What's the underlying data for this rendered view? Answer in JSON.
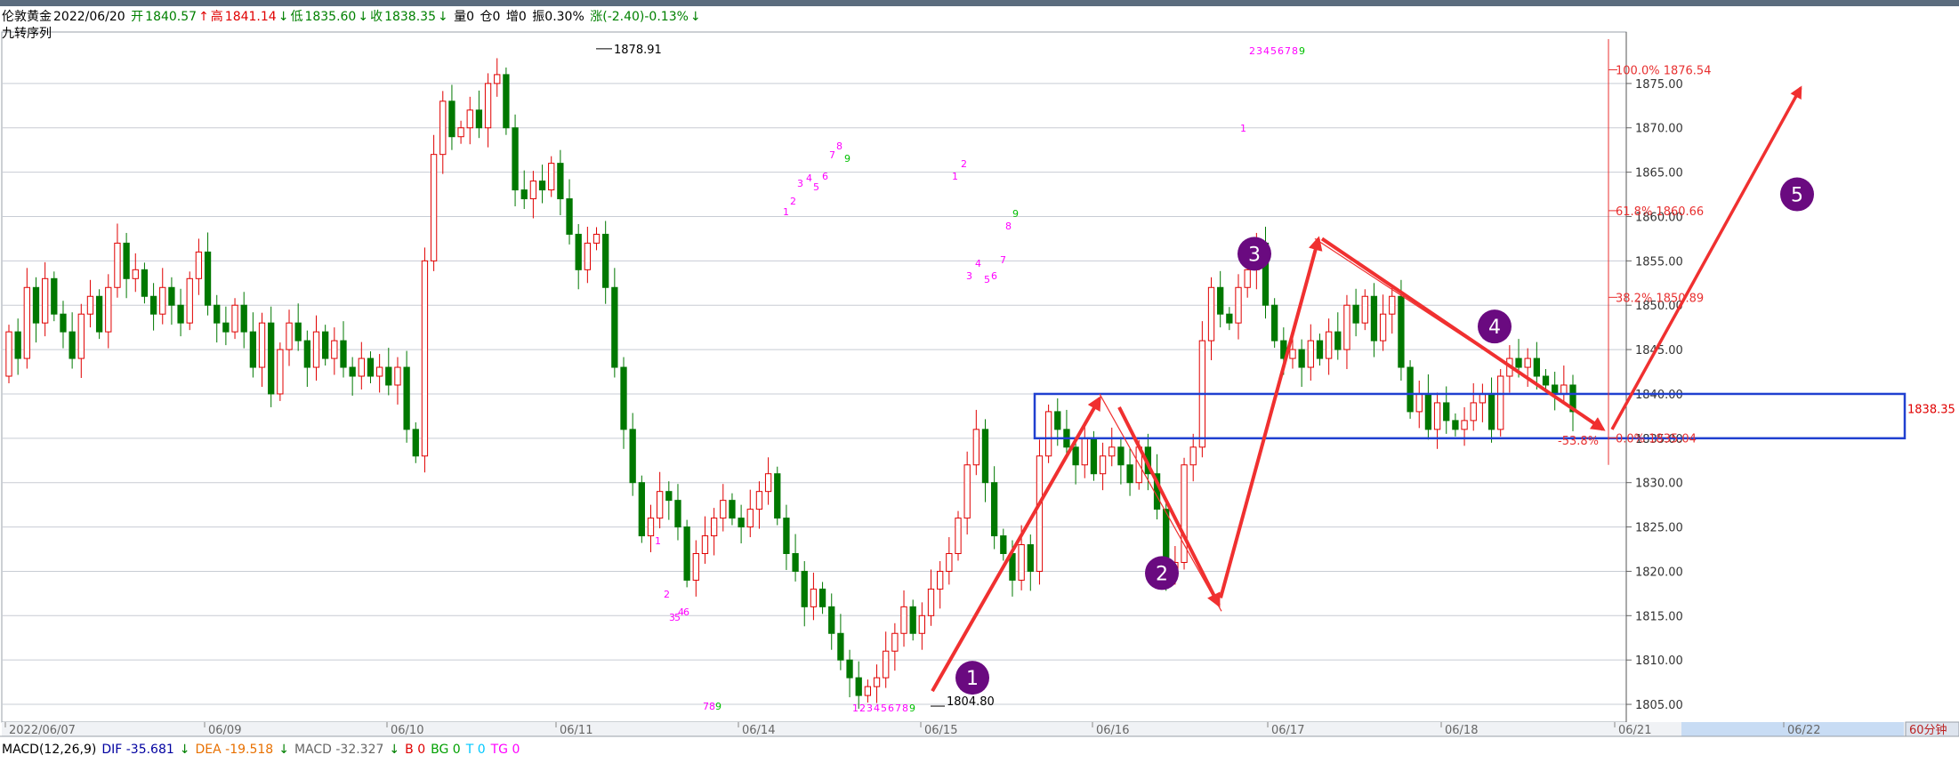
{
  "header": {
    "symbol": "伦敦黄金",
    "date": "2022/06/20",
    "open_label": "开",
    "open": "1840.57",
    "high_label": "高",
    "high": "1841.14",
    "low_label": "低",
    "low": "1835.60",
    "close_label": "收",
    "close": "1838.35",
    "vol": "量0",
    "oi": "仓0",
    "inc": "增0",
    "amp": "振0.30%",
    "chg": "涨(-2.40)-0.13%",
    "up_arrow": "↑",
    "down_arrow": "↓"
  },
  "indicator_name": "九转序列",
  "macd": {
    "params": "MACD(12,26,9)",
    "dif": "DIF -35.681",
    "dif_arrow": "↓",
    "dea": "DEA -19.518",
    "dea_arrow": "↓",
    "macd": "MACD -32.327",
    "macd_arrow": "↓",
    "b": "B 0",
    "bg": "BG 0",
    "t": "T 0",
    "tg": "TG 0"
  },
  "period": "60分钟",
  "colors": {
    "up": "#e00000",
    "down": "#007800",
    "zone": "#2040d0",
    "arrow": "#f03030",
    "circle": "#6a0a80",
    "fib": "#e83030",
    "grid": "#c8ccd4",
    "nine_a": "#ff00ff",
    "nine_b": "#00c000"
  },
  "chart_data": {
    "type": "candlestick",
    "y_axis": {
      "min": 1805,
      "max": 1875,
      "ticks": [
        "1805.00",
        "1810.00",
        "1815.00",
        "1820.00",
        "1825.00",
        "1830.00",
        "1835.00",
        "1840.00",
        "1845.00",
        "1850.00",
        "1855.00",
        "1860.00",
        "1865.00",
        "1870.00",
        "1875.00"
      ]
    },
    "x_labels": [
      "2022/06/07",
      "06/09",
      "06/10",
      "06/11",
      "06/14",
      "06/15",
      "06/16",
      "06/17",
      "06/18",
      "06/21",
      "06/22"
    ],
    "current_price": "1838.35",
    "extremes": [
      {
        "label": "1878.91",
        "price": 1878.91
      },
      {
        "label": "1804.80",
        "price": 1804.8
      }
    ],
    "candles": [
      [
        1842,
        1847
      ],
      [
        1847,
        1844
      ],
      [
        1844,
        1852
      ],
      [
        1852,
        1848
      ],
      [
        1848,
        1853
      ],
      [
        1853,
        1849
      ],
      [
        1849,
        1847
      ],
      [
        1847,
        1844
      ],
      [
        1844,
        1849
      ],
      [
        1849,
        1851
      ],
      [
        1851,
        1847
      ],
      [
        1847,
        1852
      ],
      [
        1852,
        1857
      ],
      [
        1857,
        1853
      ],
      [
        1853,
        1854
      ],
      [
        1854,
        1851
      ],
      [
        1851,
        1849
      ],
      [
        1849,
        1852
      ],
      [
        1852,
        1850
      ],
      [
        1850,
        1848
      ],
      [
        1848,
        1853
      ],
      [
        1853,
        1856
      ],
      [
        1856,
        1850
      ],
      [
        1850,
        1848
      ],
      [
        1848,
        1847
      ],
      [
        1847,
        1850
      ],
      [
        1850,
        1847
      ],
      [
        1847,
        1843
      ],
      [
        1843,
        1848
      ],
      [
        1848,
        1840
      ],
      [
        1840,
        1845
      ],
      [
        1845,
        1848
      ],
      [
        1848,
        1846
      ],
      [
        1846,
        1843
      ],
      [
        1843,
        1847
      ],
      [
        1847,
        1844
      ],
      [
        1844,
        1846
      ],
      [
        1846,
        1843
      ],
      [
        1843,
        1842
      ],
      [
        1842,
        1844
      ],
      [
        1844,
        1842
      ],
      [
        1842,
        1843
      ],
      [
        1843,
        1841
      ],
      [
        1841,
        1843
      ],
      [
        1843,
        1836
      ],
      [
        1836,
        1833
      ],
      [
        1833,
        1855
      ],
      [
        1855,
        1867
      ],
      [
        1867,
        1873
      ],
      [
        1873,
        1869
      ],
      [
        1869,
        1870
      ],
      [
        1870,
        1872
      ],
      [
        1872,
        1870
      ],
      [
        1870,
        1875
      ],
      [
        1875,
        1876
      ],
      [
        1876,
        1870
      ],
      [
        1870,
        1863
      ],
      [
        1863,
        1862
      ],
      [
        1862,
        1864
      ],
      [
        1864,
        1863
      ],
      [
        1863,
        1866
      ],
      [
        1866,
        1862
      ],
      [
        1862,
        1858
      ],
      [
        1858,
        1854
      ],
      [
        1854,
        1857
      ],
      [
        1857,
        1858
      ],
      [
        1858,
        1852
      ],
      [
        1852,
        1843
      ],
      [
        1843,
        1836
      ],
      [
        1836,
        1830
      ],
      [
        1830,
        1824
      ],
      [
        1824,
        1826
      ],
      [
        1826,
        1829
      ],
      [
        1829,
        1828
      ],
      [
        1828,
        1825
      ],
      [
        1825,
        1819
      ],
      [
        1819,
        1822
      ],
      [
        1822,
        1824
      ],
      [
        1824,
        1826
      ],
      [
        1826,
        1828
      ],
      [
        1828,
        1826
      ],
      [
        1826,
        1825
      ],
      [
        1825,
        1827
      ],
      [
        1827,
        1829
      ],
      [
        1829,
        1831
      ],
      [
        1831,
        1826
      ],
      [
        1826,
        1822
      ],
      [
        1822,
        1820
      ],
      [
        1820,
        1816
      ],
      [
        1816,
        1818
      ],
      [
        1818,
        1816
      ],
      [
        1816,
        1813
      ],
      [
        1813,
        1810
      ],
      [
        1810,
        1808
      ],
      [
        1808,
        1806
      ],
      [
        1806,
        1807
      ],
      [
        1807,
        1808
      ],
      [
        1808,
        1811
      ],
      [
        1811,
        1813
      ],
      [
        1813,
        1816
      ],
      [
        1816,
        1813
      ],
      [
        1813,
        1815
      ],
      [
        1815,
        1818
      ],
      [
        1818,
        1820
      ],
      [
        1820,
        1822
      ],
      [
        1822,
        1826
      ],
      [
        1826,
        1832
      ],
      [
        1832,
        1836
      ],
      [
        1836,
        1830
      ],
      [
        1830,
        1824
      ],
      [
        1824,
        1822
      ],
      [
        1822,
        1819
      ],
      [
        1819,
        1823
      ],
      [
        1823,
        1820
      ],
      [
        1820,
        1833
      ],
      [
        1833,
        1838
      ],
      [
        1838,
        1836
      ],
      [
        1836,
        1834
      ],
      [
        1834,
        1832
      ],
      [
        1832,
        1835
      ],
      [
        1835,
        1831
      ],
      [
        1831,
        1833
      ],
      [
        1833,
        1834
      ],
      [
        1834,
        1832
      ],
      [
        1832,
        1830
      ],
      [
        1830,
        1834
      ],
      [
        1834,
        1831
      ],
      [
        1831,
        1827
      ],
      [
        1827,
        1820
      ],
      [
        1820,
        1821
      ],
      [
        1821,
        1832
      ],
      [
        1832,
        1834
      ],
      [
        1834,
        1846
      ],
      [
        1846,
        1852
      ],
      [
        1852,
        1849
      ],
      [
        1849,
        1848
      ],
      [
        1848,
        1852
      ],
      [
        1852,
        1854
      ],
      [
        1854,
        1857
      ],
      [
        1857,
        1850
      ],
      [
        1850,
        1846
      ],
      [
        1846,
        1844
      ],
      [
        1844,
        1845
      ],
      [
        1845,
        1843
      ],
      [
        1843,
        1846
      ],
      [
        1846,
        1844
      ],
      [
        1844,
        1847
      ],
      [
        1847,
        1845
      ],
      [
        1845,
        1850
      ],
      [
        1850,
        1848
      ],
      [
        1848,
        1851
      ],
      [
        1851,
        1846
      ],
      [
        1846,
        1849
      ],
      [
        1849,
        1851
      ],
      [
        1851,
        1843
      ],
      [
        1843,
        1838
      ],
      [
        1838,
        1840
      ],
      [
        1840,
        1836
      ],
      [
        1836,
        1839
      ],
      [
        1839,
        1837
      ],
      [
        1837,
        1836
      ],
      [
        1836,
        1837
      ],
      [
        1837,
        1839
      ],
      [
        1839,
        1840
      ],
      [
        1840,
        1836
      ],
      [
        1836,
        1842
      ],
      [
        1842,
        1844
      ],
      [
        1844,
        1843
      ],
      [
        1843,
        1844
      ],
      [
        1844,
        1842
      ],
      [
        1842,
        1841
      ],
      [
        1841,
        1840
      ],
      [
        1840,
        1841
      ],
      [
        1841,
        1838
      ]
    ],
    "fibonacci": [
      {
        "label": "100.0% 1876.54",
        "price": 1876.54
      },
      {
        "label": "61.8% 1860.66",
        "price": 1860.66
      },
      {
        "label": "38.2% 1850.89",
        "price": 1850.89
      },
      {
        "label": "0.0% 1835.04",
        "price": 1835.04
      }
    ],
    "extension_label": "-53.8%",
    "zone": {
      "low": 1835.0,
      "high": 1840.0
    },
    "waves": [
      "1",
      "2",
      "3",
      "4",
      "5"
    ],
    "td_sequences": [
      {
        "digits": "1",
        "color": "#ff00ff"
      },
      {
        "digits": "2",
        "color": "#ff00ff"
      },
      {
        "digits": "3",
        "color": "#ff00ff"
      },
      {
        "digits": "4",
        "color": "#ff00ff"
      },
      {
        "digits": "5",
        "color": "#ff00ff"
      },
      {
        "digits": "6",
        "color": "#ff00ff"
      },
      {
        "digits": "7",
        "color": "#ff00ff"
      },
      {
        "digits": "8",
        "color": "#ff00ff"
      },
      {
        "digits": "9",
        "color": "#00c000"
      }
    ]
  }
}
